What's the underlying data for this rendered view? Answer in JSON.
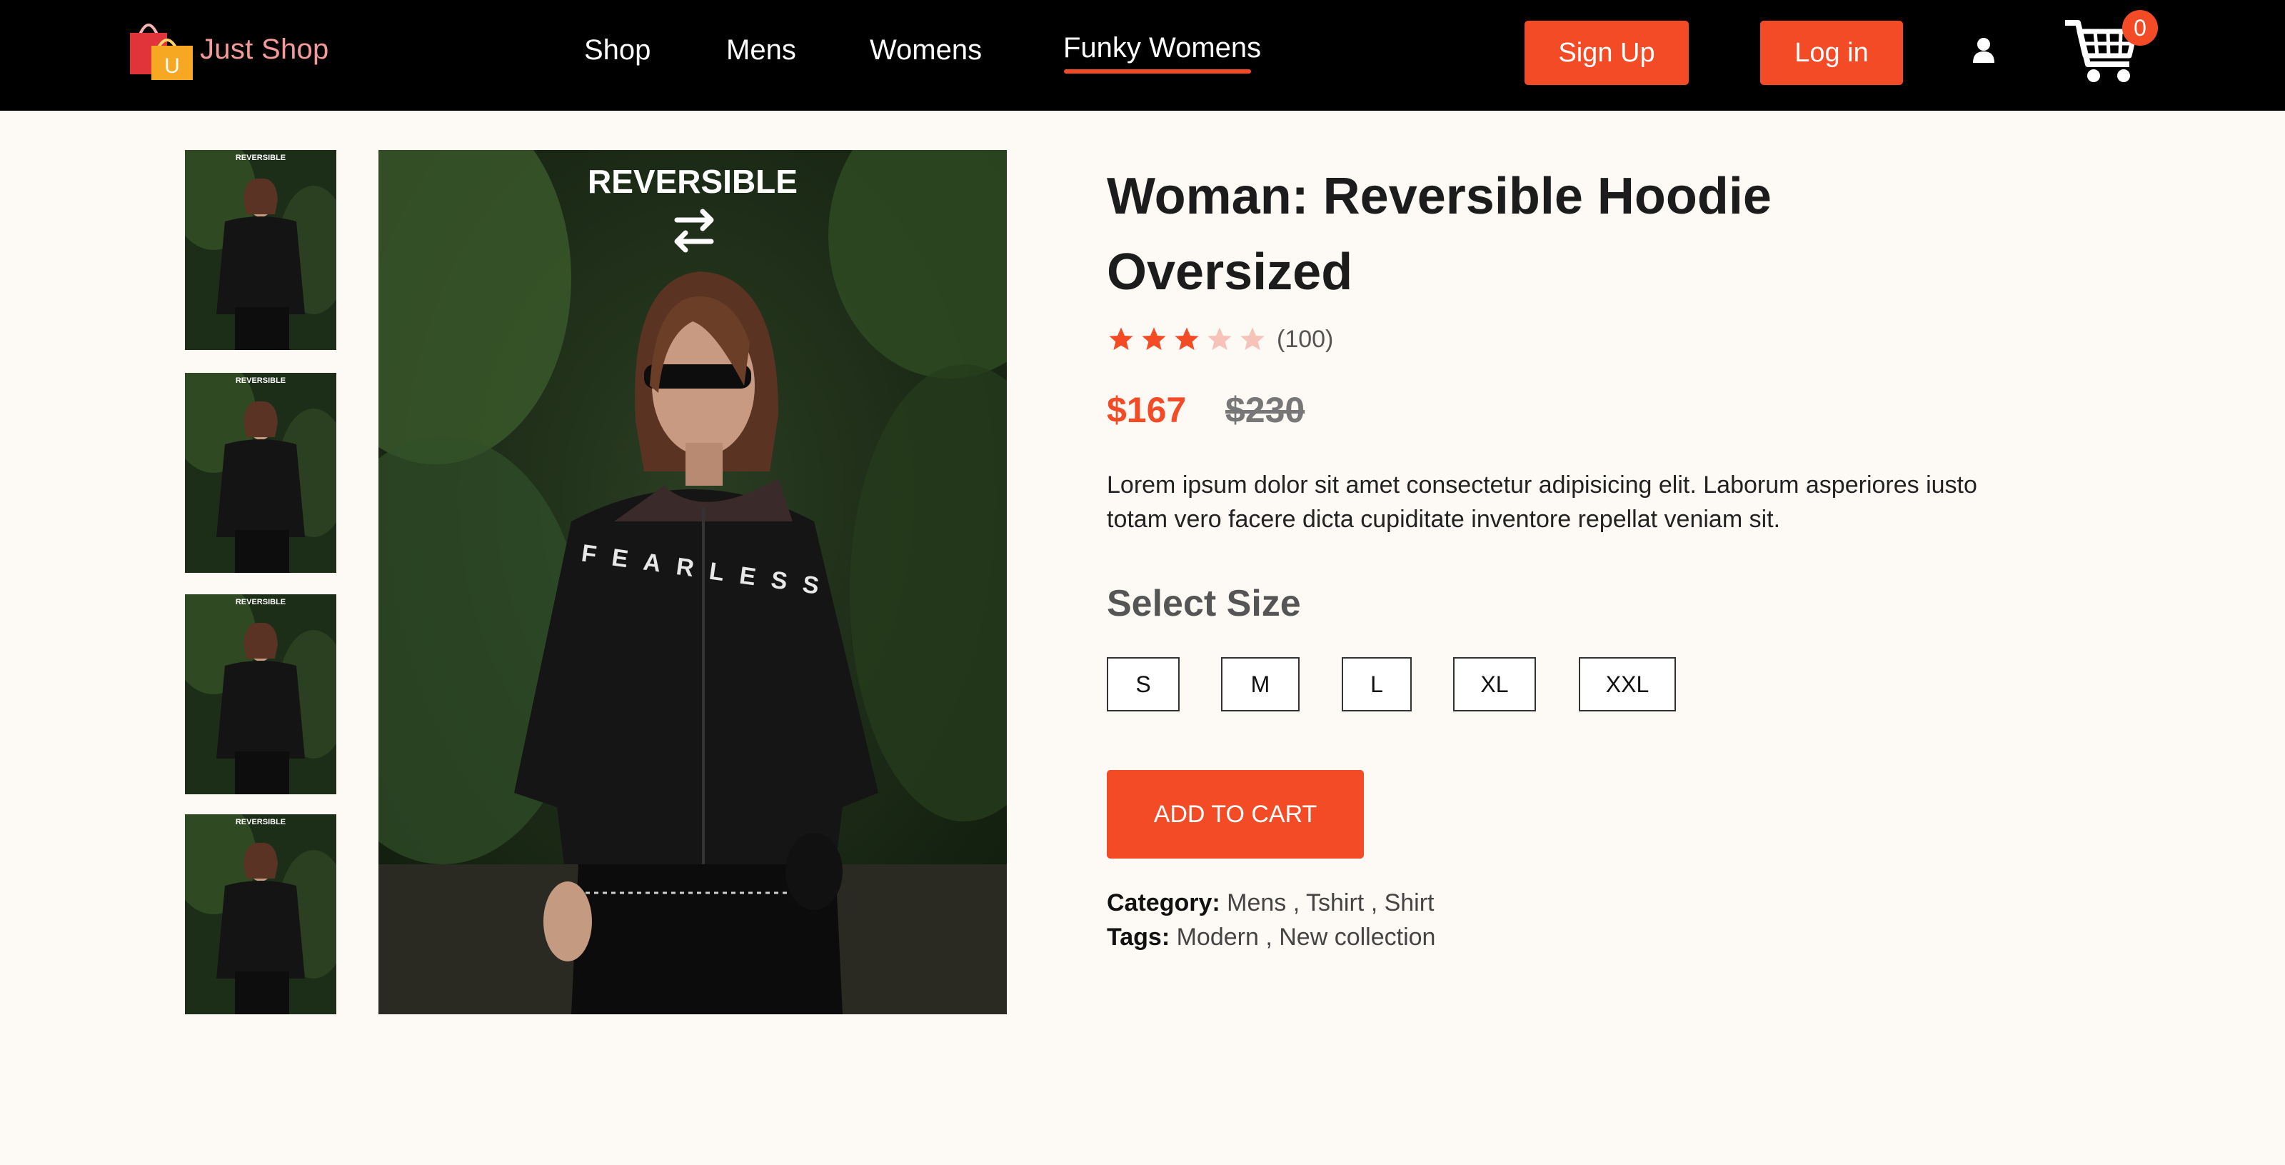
{
  "header": {
    "brand": "Just Shop",
    "logo_letter": "U",
    "nav": [
      "Shop",
      "Mens",
      "Womens",
      "Funky Womens"
    ],
    "active_nav": "Funky Womens",
    "signup_label": "Sign Up",
    "login_label": "Log in",
    "cart_count": "0",
    "icons": [
      "shopping-bag-logo-icon",
      "user-icon",
      "cart-icon"
    ]
  },
  "gallery": {
    "image_caption": "REVERSIBLE",
    "shirt_text": "FEARLESS",
    "thumbnail_count": 4
  },
  "product": {
    "title": "Woman: Reversible Hoodie Oversized",
    "rating": 3,
    "rating_max": 5,
    "review_count": "(100)",
    "price": "$167",
    "old_price": "$230",
    "description": "Lorem ipsum dolor sit amet consectetur adipisicing elit. Laborum asperiores iusto totam vero facere dicta cupiditate inventore repellat veniam sit.",
    "size_heading": "Select Size",
    "sizes": [
      "S",
      "M",
      "L",
      "XL",
      "XXL"
    ],
    "add_to_cart_label": "ADD TO CART",
    "category_label": "Category:",
    "category_value": "Mens , Tshirt , Shirt",
    "tags_label": "Tags:",
    "tags_value": "Modern , New collection"
  },
  "colors": {
    "accent": "#f44b27",
    "navbar": "#000000",
    "background": "#fdf9f4",
    "star_empty": "#f7c2b8"
  }
}
